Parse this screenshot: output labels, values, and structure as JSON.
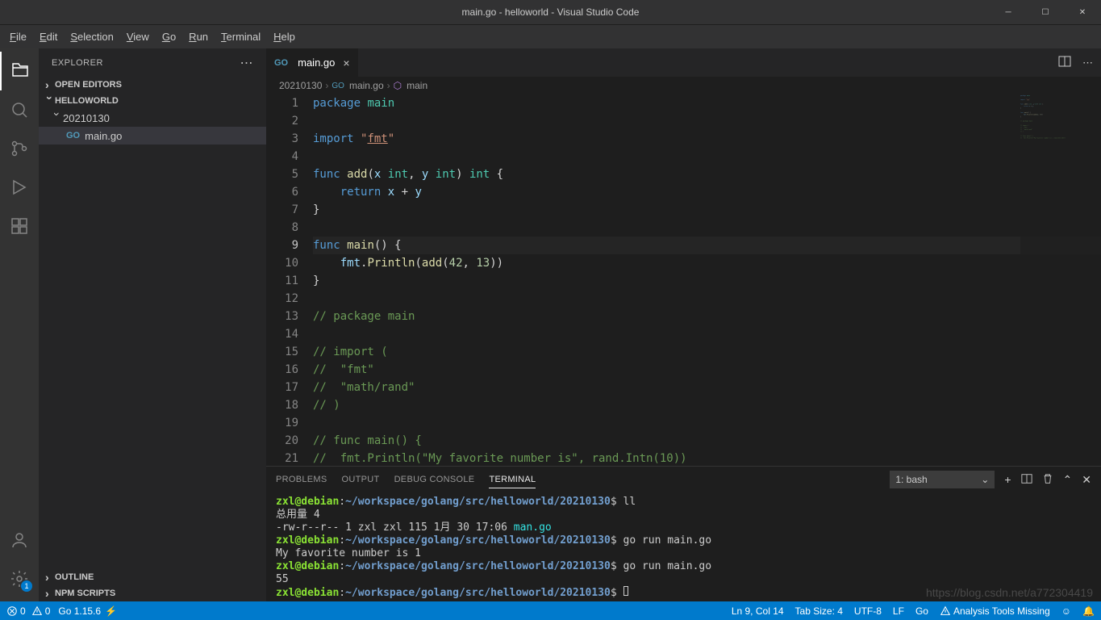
{
  "window": {
    "title": "main.go - helloworld - Visual Studio Code"
  },
  "menu": {
    "items": [
      {
        "label": "File",
        "accel": "F"
      },
      {
        "label": "Edit",
        "accel": "E"
      },
      {
        "label": "Selection",
        "accel": "S"
      },
      {
        "label": "View",
        "accel": "V"
      },
      {
        "label": "Go",
        "accel": "G"
      },
      {
        "label": "Run",
        "accel": "R"
      },
      {
        "label": "Terminal",
        "accel": "T"
      },
      {
        "label": "Help",
        "accel": "H"
      }
    ]
  },
  "sidebar": {
    "title": "EXPLORER",
    "sections": {
      "open_editors": "OPEN EDITORS",
      "project": "HELLOWORLD",
      "outline": "OUTLINE",
      "npm": "NPM SCRIPTS"
    },
    "tree": {
      "folder": "20210130",
      "file": "main.go"
    }
  },
  "tabs": {
    "active": "main.go"
  },
  "breadcrumbs": {
    "p1": "20210130",
    "p2": "main.go",
    "p3": "main"
  },
  "editor": {
    "line_start": 1,
    "line_end": 21,
    "current_line": 9,
    "code_lines": [
      [
        {
          "t": "kw",
          "v": "package"
        },
        {
          "t": "txt",
          "v": " "
        },
        {
          "t": "pkg",
          "v": "main"
        }
      ],
      [],
      [
        {
          "t": "kw",
          "v": "import"
        },
        {
          "t": "txt",
          "v": " "
        },
        {
          "t": "str",
          "v": "\""
        },
        {
          "t": "str-u",
          "v": "fmt"
        },
        {
          "t": "str",
          "v": "\""
        }
      ],
      [],
      [
        {
          "t": "kw",
          "v": "func"
        },
        {
          "t": "txt",
          "v": " "
        },
        {
          "t": "fn",
          "v": "add"
        },
        {
          "t": "txt",
          "v": "("
        },
        {
          "t": "var",
          "v": "x"
        },
        {
          "t": "txt",
          "v": " "
        },
        {
          "t": "typ",
          "v": "int"
        },
        {
          "t": "txt",
          "v": ", "
        },
        {
          "t": "var",
          "v": "y"
        },
        {
          "t": "txt",
          "v": " "
        },
        {
          "t": "typ",
          "v": "int"
        },
        {
          "t": "txt",
          "v": ") "
        },
        {
          "t": "typ",
          "v": "int"
        },
        {
          "t": "txt",
          "v": " {"
        }
      ],
      [
        {
          "t": "txt",
          "v": "    "
        },
        {
          "t": "kw",
          "v": "return"
        },
        {
          "t": "txt",
          "v": " "
        },
        {
          "t": "var",
          "v": "x"
        },
        {
          "t": "txt",
          "v": " + "
        },
        {
          "t": "var",
          "v": "y"
        }
      ],
      [
        {
          "t": "txt",
          "v": "}"
        }
      ],
      [],
      [
        {
          "t": "kw",
          "v": "func"
        },
        {
          "t": "txt",
          "v": " "
        },
        {
          "t": "fn",
          "v": "main"
        },
        {
          "t": "txt",
          "v": "() {"
        }
      ],
      [
        {
          "t": "txt",
          "v": "    "
        },
        {
          "t": "var",
          "v": "fmt"
        },
        {
          "t": "txt",
          "v": "."
        },
        {
          "t": "fn",
          "v": "Println"
        },
        {
          "t": "txt",
          "v": "("
        },
        {
          "t": "fn",
          "v": "add"
        },
        {
          "t": "txt",
          "v": "("
        },
        {
          "t": "num",
          "v": "42"
        },
        {
          "t": "txt",
          "v": ", "
        },
        {
          "t": "num",
          "v": "13"
        },
        {
          "t": "txt",
          "v": "))"
        }
      ],
      [
        {
          "t": "txt",
          "v": "}"
        }
      ],
      [],
      [
        {
          "t": "cmt",
          "v": "// package main"
        }
      ],
      [],
      [
        {
          "t": "cmt",
          "v": "// import ("
        }
      ],
      [
        {
          "t": "cmt",
          "v": "//  \"fmt\""
        }
      ],
      [
        {
          "t": "cmt",
          "v": "//  \"math/rand\""
        }
      ],
      [
        {
          "t": "cmt",
          "v": "// )"
        }
      ],
      [],
      [
        {
          "t": "cmt",
          "v": "// func main() {"
        }
      ],
      [
        {
          "t": "cmt",
          "v": "//  fmt.Println(\"My favorite number is\", rand.Intn(10))"
        }
      ]
    ]
  },
  "panel": {
    "tabs": {
      "problems": "PROBLEMS",
      "output": "OUTPUT",
      "debug": "DEBUG CONSOLE",
      "terminal": "TERMINAL"
    },
    "terminal_select": "1: bash",
    "terminal_lines": [
      {
        "prompt": {
          "user": "zxl@debian",
          "sep": ":",
          "path": "~/workspace/golang/src/helloworld/20210130",
          "sym": "$"
        },
        "cmd": " ll"
      },
      {
        "text": "总用量 4"
      },
      {
        "text": "-rw-r--r-- 1 zxl zxl 115 1月  30 17:06 ",
        "file": "man.go"
      },
      {
        "prompt": {
          "user": "zxl@debian",
          "sep": ":",
          "path": "~/workspace/golang/src/helloworld/20210130",
          "sym": "$"
        },
        "cmd": " go run main.go"
      },
      {
        "text": "My favorite number is 1"
      },
      {
        "prompt": {
          "user": "zxl@debian",
          "sep": ":",
          "path": "~/workspace/golang/src/helloworld/20210130",
          "sym": "$"
        },
        "cmd": " go run main.go"
      },
      {
        "text": "55"
      },
      {
        "prompt": {
          "user": "zxl@debian",
          "sep": ":",
          "path": "~/workspace/golang/src/helloworld/20210130",
          "sym": "$"
        },
        "cmd": " ",
        "cursor": true
      }
    ]
  },
  "status": {
    "errors": "0",
    "warnings": "0",
    "go_version": "Go 1.15.6",
    "cursor": "Ln 9, Col 14",
    "tab_size": "Tab Size: 4",
    "encoding": "UTF-8",
    "eol": "LF",
    "lang": "Go",
    "analysis": "Analysis Tools Missing"
  },
  "watermark": "https://blog.csdn.net/a772304419",
  "settings_badge": "1"
}
